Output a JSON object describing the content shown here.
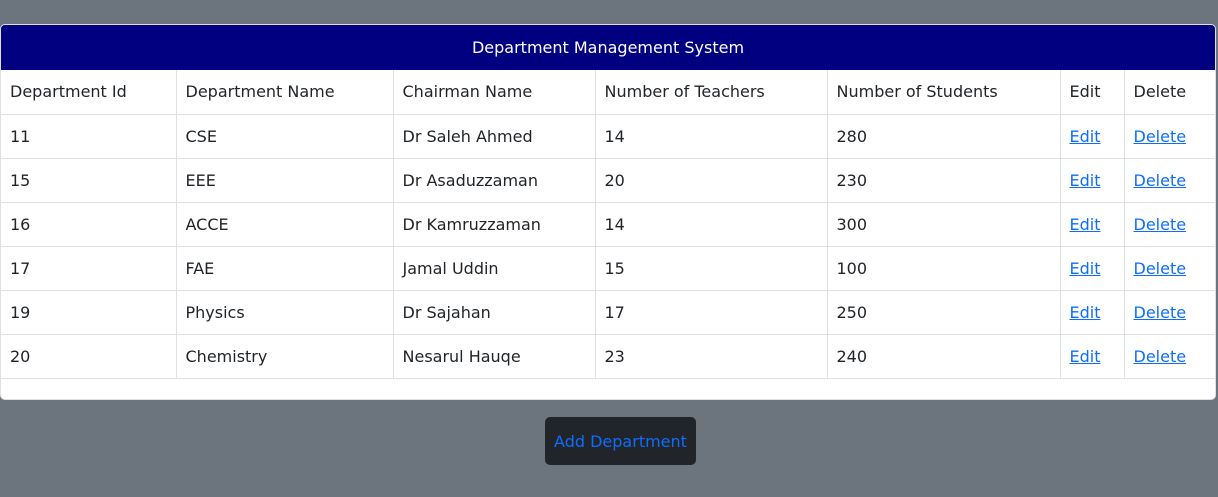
{
  "header": {
    "title": "Department Management System"
  },
  "table": {
    "columns": [
      "Department Id",
      "Department Name",
      "Chairman Name",
      "Number of Teachers",
      "Number of Students",
      "Edit",
      "Delete"
    ],
    "rows": [
      {
        "id": "11",
        "name": "CSE",
        "chairman": "Dr Saleh Ahmed",
        "teachers": "14",
        "students": "280",
        "edit": "Edit",
        "delete": "Delete"
      },
      {
        "id": "15",
        "name": "EEE",
        "chairman": "Dr Asaduzzaman",
        "teachers": "20",
        "students": "230",
        "edit": "Edit",
        "delete": "Delete"
      },
      {
        "id": "16",
        "name": "ACCE",
        "chairman": "Dr Kamruzzaman",
        "teachers": "14",
        "students": "300",
        "edit": "Edit",
        "delete": "Delete"
      },
      {
        "id": "17",
        "name": "FAE",
        "chairman": "Jamal Uddin",
        "teachers": "15",
        "students": "100",
        "edit": "Edit",
        "delete": "Delete"
      },
      {
        "id": "19",
        "name": "Physics",
        "chairman": "Dr Sajahan",
        "teachers": "17",
        "students": "250",
        "edit": "Edit",
        "delete": "Delete"
      },
      {
        "id": "20",
        "name": "Chemistry",
        "chairman": "Nesarul Hauqe",
        "teachers": "23",
        "students": "240",
        "edit": "Edit",
        "delete": "Delete"
      }
    ]
  },
  "actions": {
    "add_label": "Add Department"
  }
}
